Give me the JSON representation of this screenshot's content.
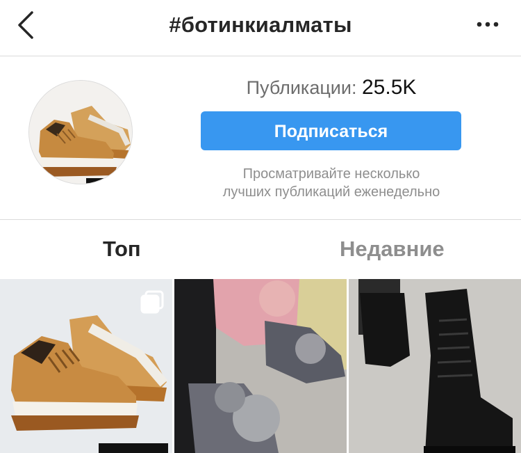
{
  "header": {
    "title": "#ботинкиалматы",
    "back_icon": "chevron-left-icon",
    "more_icon": "more-horizontal-icon"
  },
  "profile": {
    "stats_label": "Публикации:",
    "stats_value": "25.5K",
    "follow_label": "Подписаться",
    "description_line1": "Просматривайте несколько",
    "description_line2": "лучших публикаций еженедельно"
  },
  "tabs": [
    {
      "label": "Топ",
      "active": true
    },
    {
      "label": "Недавние",
      "active": false
    }
  ],
  "grid": {
    "items": [
      {
        "alt": "shoe-photo-1",
        "icon": "multiple-posts-icon"
      },
      {
        "alt": "shoe-photo-2"
      },
      {
        "alt": "shoe-photo-3"
      }
    ]
  },
  "colors": {
    "accent": "#3897f0",
    "muted": "#8e8e8e",
    "divider": "#dbdbdb",
    "text": "#262626"
  }
}
